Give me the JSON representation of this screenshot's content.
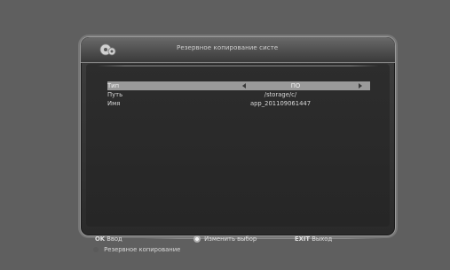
{
  "dialog": {
    "title": "Резервное копирование систе",
    "rows": [
      {
        "label": "Тип",
        "value": "ПО"
      },
      {
        "label": "Путь",
        "value": "/storage/c/"
      },
      {
        "label": "Имя",
        "value": "app_201109061447"
      }
    ]
  },
  "backup_action": "Резервное копирование",
  "footer": {
    "ok_key": "OK",
    "ok_label": "Ввод",
    "nav_label": "Изменить выбор",
    "exit_key": "EXIT",
    "exit_label": "Выход"
  },
  "icons": [
    "settings-gear-icon",
    "arrow-left-icon",
    "arrow-right-icon",
    "nav-dpad-icon",
    "bullet-icon"
  ]
}
